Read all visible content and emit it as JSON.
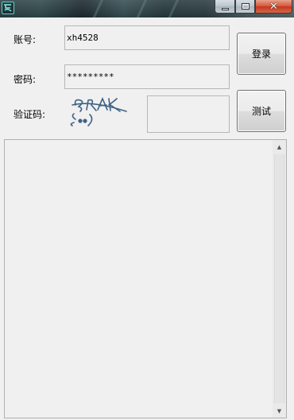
{
  "window": {
    "icon": "app-logo-icon",
    "controls": {
      "minimize": "minimize-icon",
      "maximize": "maximize-icon",
      "close": "close-icon"
    }
  },
  "form": {
    "account_label": "账号:",
    "account_value": "xh4528",
    "password_label": "密码:",
    "password_value": "*********",
    "captcha_label": "验证码:",
    "captcha_input_value": ""
  },
  "buttons": {
    "login": "登录",
    "test": "测试"
  },
  "output": {
    "text": ""
  },
  "colors": {
    "window_bg": "#f0f0f0",
    "close_button": "#c5371c",
    "captcha_ink": "#3f6184"
  }
}
